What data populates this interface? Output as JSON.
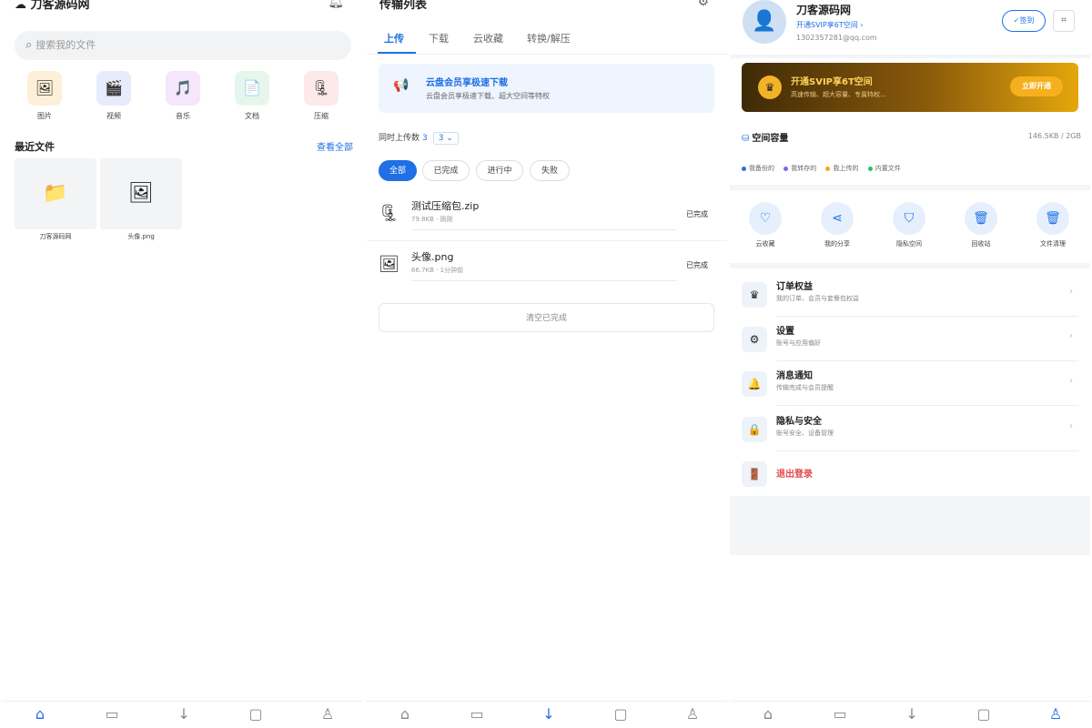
{
  "home": {
    "title": "刀客源码网",
    "search_placeholder": "搜索我的文件",
    "categories": [
      "图片",
      "视频",
      "音乐",
      "文档",
      "压缩"
    ],
    "recent_title": "最近文件",
    "view_all": "查看全部",
    "recent_files": [
      "刀客源码网",
      "头像.png"
    ]
  },
  "transfer": {
    "title": "传输列表",
    "tabs": [
      "上传",
      "下载",
      "云收藏",
      "转换/解压"
    ],
    "promo_title": "云盘会员享极速下载",
    "promo_sub": "云盘会员享极速下载、超大空间等特权",
    "concurrency_label": "同时上传数",
    "concurrency_value": "3",
    "concurrency_select": "3",
    "filters": [
      "全部",
      "已完成",
      "进行中",
      "失败"
    ],
    "files": [
      {
        "name": "测试压缩包.zip",
        "meta": "79.8KB · 刚刚",
        "status": "已完成"
      },
      {
        "name": "头像.png",
        "meta": "66.7KB · 1分钟前",
        "status": "已完成"
      }
    ],
    "clear_label": "清空已完成"
  },
  "profile": {
    "name": "刀客源码网",
    "svip": "开通SVIP享6T空间 ›",
    "email": "1302357281@qq.com",
    "sign": "✓签到",
    "vip_title": "开通SVIP享6T空间",
    "vip_sub": "高速传输、超大容量、专属特权...",
    "vip_btn": "立即开通",
    "capacity_title": "空间容量",
    "capacity_value": "146.5KB / 2GB",
    "legend": [
      "我备份的",
      "我转存的",
      "我上传的",
      "内置文件"
    ],
    "shortcuts": [
      "云收藏",
      "我的分享",
      "隐私空间",
      "回收站",
      "文件清理"
    ],
    "menu": [
      {
        "title": "订单权益",
        "sub": "我的订单、会员与套餐包权益"
      },
      {
        "title": "设置",
        "sub": "账号与应用偏好"
      },
      {
        "title": "消息通知",
        "sub": "传输完成与会员提醒"
      },
      {
        "title": "隐私与安全",
        "sub": "账号安全、设备管理"
      }
    ],
    "logout": "退出登录"
  },
  "colors": {
    "accent": "#1f6fe5",
    "danger": "#e24b4b",
    "vip_gold": "#f6b01e"
  },
  "icons": {
    "nav": [
      "home-icon",
      "folder-icon",
      "download-icon",
      "chat-icon",
      "user-icon"
    ],
    "legend_colors": [
      "#2f6fe0",
      "#8b5cf6",
      "#f5a623",
      "#22c55e"
    ]
  }
}
